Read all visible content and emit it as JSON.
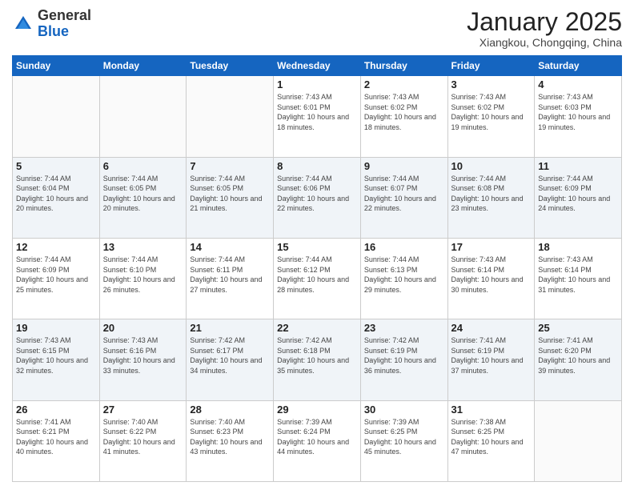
{
  "logo": {
    "general": "General",
    "blue": "Blue"
  },
  "header": {
    "month": "January 2025",
    "location": "Xiangkou, Chongqing, China"
  },
  "days_of_week": [
    "Sunday",
    "Monday",
    "Tuesday",
    "Wednesday",
    "Thursday",
    "Friday",
    "Saturday"
  ],
  "weeks": [
    [
      {
        "num": "",
        "info": ""
      },
      {
        "num": "",
        "info": ""
      },
      {
        "num": "",
        "info": ""
      },
      {
        "num": "1",
        "info": "Sunrise: 7:43 AM\nSunset: 6:01 PM\nDaylight: 10 hours and 18 minutes."
      },
      {
        "num": "2",
        "info": "Sunrise: 7:43 AM\nSunset: 6:02 PM\nDaylight: 10 hours and 18 minutes."
      },
      {
        "num": "3",
        "info": "Sunrise: 7:43 AM\nSunset: 6:02 PM\nDaylight: 10 hours and 19 minutes."
      },
      {
        "num": "4",
        "info": "Sunrise: 7:43 AM\nSunset: 6:03 PM\nDaylight: 10 hours and 19 minutes."
      }
    ],
    [
      {
        "num": "5",
        "info": "Sunrise: 7:44 AM\nSunset: 6:04 PM\nDaylight: 10 hours and 20 minutes."
      },
      {
        "num": "6",
        "info": "Sunrise: 7:44 AM\nSunset: 6:05 PM\nDaylight: 10 hours and 20 minutes."
      },
      {
        "num": "7",
        "info": "Sunrise: 7:44 AM\nSunset: 6:05 PM\nDaylight: 10 hours and 21 minutes."
      },
      {
        "num": "8",
        "info": "Sunrise: 7:44 AM\nSunset: 6:06 PM\nDaylight: 10 hours and 22 minutes."
      },
      {
        "num": "9",
        "info": "Sunrise: 7:44 AM\nSunset: 6:07 PM\nDaylight: 10 hours and 22 minutes."
      },
      {
        "num": "10",
        "info": "Sunrise: 7:44 AM\nSunset: 6:08 PM\nDaylight: 10 hours and 23 minutes."
      },
      {
        "num": "11",
        "info": "Sunrise: 7:44 AM\nSunset: 6:09 PM\nDaylight: 10 hours and 24 minutes."
      }
    ],
    [
      {
        "num": "12",
        "info": "Sunrise: 7:44 AM\nSunset: 6:09 PM\nDaylight: 10 hours and 25 minutes."
      },
      {
        "num": "13",
        "info": "Sunrise: 7:44 AM\nSunset: 6:10 PM\nDaylight: 10 hours and 26 minutes."
      },
      {
        "num": "14",
        "info": "Sunrise: 7:44 AM\nSunset: 6:11 PM\nDaylight: 10 hours and 27 minutes."
      },
      {
        "num": "15",
        "info": "Sunrise: 7:44 AM\nSunset: 6:12 PM\nDaylight: 10 hours and 28 minutes."
      },
      {
        "num": "16",
        "info": "Sunrise: 7:44 AM\nSunset: 6:13 PM\nDaylight: 10 hours and 29 minutes."
      },
      {
        "num": "17",
        "info": "Sunrise: 7:43 AM\nSunset: 6:14 PM\nDaylight: 10 hours and 30 minutes."
      },
      {
        "num": "18",
        "info": "Sunrise: 7:43 AM\nSunset: 6:14 PM\nDaylight: 10 hours and 31 minutes."
      }
    ],
    [
      {
        "num": "19",
        "info": "Sunrise: 7:43 AM\nSunset: 6:15 PM\nDaylight: 10 hours and 32 minutes."
      },
      {
        "num": "20",
        "info": "Sunrise: 7:43 AM\nSunset: 6:16 PM\nDaylight: 10 hours and 33 minutes."
      },
      {
        "num": "21",
        "info": "Sunrise: 7:42 AM\nSunset: 6:17 PM\nDaylight: 10 hours and 34 minutes."
      },
      {
        "num": "22",
        "info": "Sunrise: 7:42 AM\nSunset: 6:18 PM\nDaylight: 10 hours and 35 minutes."
      },
      {
        "num": "23",
        "info": "Sunrise: 7:42 AM\nSunset: 6:19 PM\nDaylight: 10 hours and 36 minutes."
      },
      {
        "num": "24",
        "info": "Sunrise: 7:41 AM\nSunset: 6:19 PM\nDaylight: 10 hours and 37 minutes."
      },
      {
        "num": "25",
        "info": "Sunrise: 7:41 AM\nSunset: 6:20 PM\nDaylight: 10 hours and 39 minutes."
      }
    ],
    [
      {
        "num": "26",
        "info": "Sunrise: 7:41 AM\nSunset: 6:21 PM\nDaylight: 10 hours and 40 minutes."
      },
      {
        "num": "27",
        "info": "Sunrise: 7:40 AM\nSunset: 6:22 PM\nDaylight: 10 hours and 41 minutes."
      },
      {
        "num": "28",
        "info": "Sunrise: 7:40 AM\nSunset: 6:23 PM\nDaylight: 10 hours and 43 minutes."
      },
      {
        "num": "29",
        "info": "Sunrise: 7:39 AM\nSunset: 6:24 PM\nDaylight: 10 hours and 44 minutes."
      },
      {
        "num": "30",
        "info": "Sunrise: 7:39 AM\nSunset: 6:25 PM\nDaylight: 10 hours and 45 minutes."
      },
      {
        "num": "31",
        "info": "Sunrise: 7:38 AM\nSunset: 6:25 PM\nDaylight: 10 hours and 47 minutes."
      },
      {
        "num": "",
        "info": ""
      }
    ]
  ]
}
